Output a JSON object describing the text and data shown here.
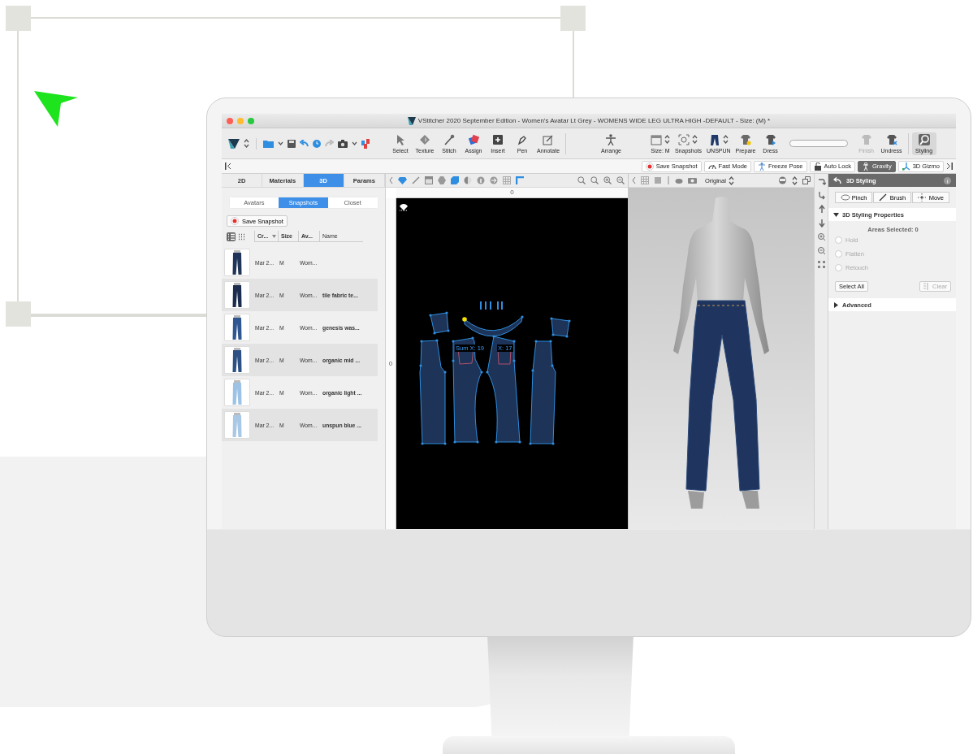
{
  "window": {
    "title": "VStitcher 2020 September Edition - Women's Avatar Lt Grey - WOMENS WIDE LEG ULTRA HIGH -DEFAULT - Size: (M) *"
  },
  "toolbar": {
    "groups": [
      {
        "items": [
          {
            "kind": "tool",
            "label": "Select",
            "selected": false,
            "disabled": false
          },
          {
            "kind": "tool",
            "label": "Texture",
            "selected": false,
            "disabled": false
          },
          {
            "kind": "tool",
            "label": "Stitch",
            "selected": false,
            "disabled": false
          },
          {
            "kind": "tool",
            "label": "Assign",
            "selected": false,
            "disabled": false
          },
          {
            "kind": "tool",
            "label": "Insert",
            "selected": false,
            "disabled": false
          },
          {
            "kind": "tool",
            "label": "Pen",
            "selected": false,
            "disabled": false
          },
          {
            "kind": "tool",
            "label": "Annotate",
            "selected": false,
            "disabled": false
          }
        ]
      },
      {
        "items": [
          {
            "kind": "tool",
            "label": "Arrange",
            "selected": false,
            "disabled": false
          }
        ]
      },
      {
        "items": [
          {
            "kind": "stepper",
            "label": "Size: M",
            "selected": false,
            "disabled": false
          },
          {
            "kind": "stepper",
            "label": "Snapshots",
            "selected": false,
            "disabled": false
          },
          {
            "kind": "stepper",
            "label": "UNSPUN",
            "selected": false,
            "disabled": false
          }
        ]
      },
      {
        "items": [
          {
            "kind": "tool",
            "label": "Prepare",
            "selected": false,
            "disabled": false
          },
          {
            "kind": "tool",
            "label": "Dress",
            "selected": false,
            "disabled": false
          },
          {
            "kind": "progress",
            "level": 0
          },
          {
            "kind": "tool",
            "label": "Finish",
            "selected": false,
            "disabled": true
          },
          {
            "kind": "tool",
            "label": "Undress",
            "selected": false,
            "disabled": false
          }
        ]
      },
      {
        "items": [
          {
            "kind": "tool",
            "label": "Styling",
            "selected": true,
            "disabled": false
          }
        ]
      }
    ]
  },
  "action_bar": {
    "buttons": [
      {
        "label": "Save Snapshot",
        "on": false
      },
      {
        "label": "Fast Mode",
        "on": false
      },
      {
        "label": "Freeze Pose",
        "on": false
      },
      {
        "label": "Auto Lock",
        "on": false
      },
      {
        "label": "Gravity",
        "on": true
      },
      {
        "label": "3D Gizmo",
        "on": false
      }
    ]
  },
  "left_panel": {
    "tabs": [
      {
        "label": "2D",
        "selected": false
      },
      {
        "label": "Materials",
        "selected": false
      },
      {
        "label": "3D",
        "selected": true
      },
      {
        "label": "Params",
        "selected": false
      }
    ],
    "subtabs": [
      {
        "label": "Avatars",
        "selected": false
      },
      {
        "label": "Snapshots",
        "selected": true
      },
      {
        "label": "Closet",
        "selected": false
      }
    ],
    "save_button": "Save Snapshot",
    "view_modes": [
      {
        "selected": true
      },
      {
        "selected": false
      }
    ],
    "columns": [
      {
        "label": "Cr...",
        "sorted": true
      },
      {
        "label": "Size",
        "sorted": false
      },
      {
        "label": "Av...",
        "sorted": false
      },
      {
        "label": "Name",
        "sorted": false
      }
    ],
    "rows": [
      {
        "created": "Mar 2...",
        "size": "M",
        "avatar": "Wom...",
        "color": "#1f3358"
      },
      {
        "created": "Mar 2...",
        "size": "M",
        "avatar": "Wom...",
        "name": "tile fabric te...",
        "color": "#1c2c4e"
      },
      {
        "created": "Mar 2...",
        "size": "M",
        "avatar": "Wom...",
        "name": "genesis was...",
        "color": "#2f5690"
      },
      {
        "created": "Mar 2...",
        "size": "M",
        "avatar": "Wom...",
        "name": "organic mid ...",
        "color": "#2c4f84"
      },
      {
        "created": "Mar 2...",
        "size": "M",
        "avatar": "Wom...",
        "name": "organic light ...",
        "color": "#9cc3e6"
      },
      {
        "created": "Mar 2...",
        "size": "M",
        "avatar": "Wom...",
        "name": "unspun blue ...",
        "color": "#a9c8e6"
      }
    ]
  },
  "pattern_view": {
    "ruler_label": "0",
    "vertical_ruler_label": "0",
    "measurements": [
      "Sum X: 19",
      "X: 17"
    ]
  },
  "avatar_view": {
    "display_mode": "Original"
  },
  "styling_panel": {
    "title": "3D Styling",
    "tools": [
      "Pinch",
      "Brush",
      "Move"
    ],
    "sections": [
      {
        "title": "3D Styling Properties",
        "expanded": true
      },
      {
        "title": "Advanced",
        "expanded": false
      }
    ],
    "areas_selected": "Areas Selected: 0",
    "options": [
      {
        "label": "Hold",
        "checked": false,
        "disabled": true
      },
      {
        "label": "Flatten",
        "checked": false,
        "disabled": true
      },
      {
        "label": "Retouch",
        "checked": false,
        "disabled": true
      }
    ],
    "buttons": [
      {
        "label": "Select All",
        "disabled": false
      },
      {
        "label": "Clear",
        "disabled": true
      }
    ]
  }
}
